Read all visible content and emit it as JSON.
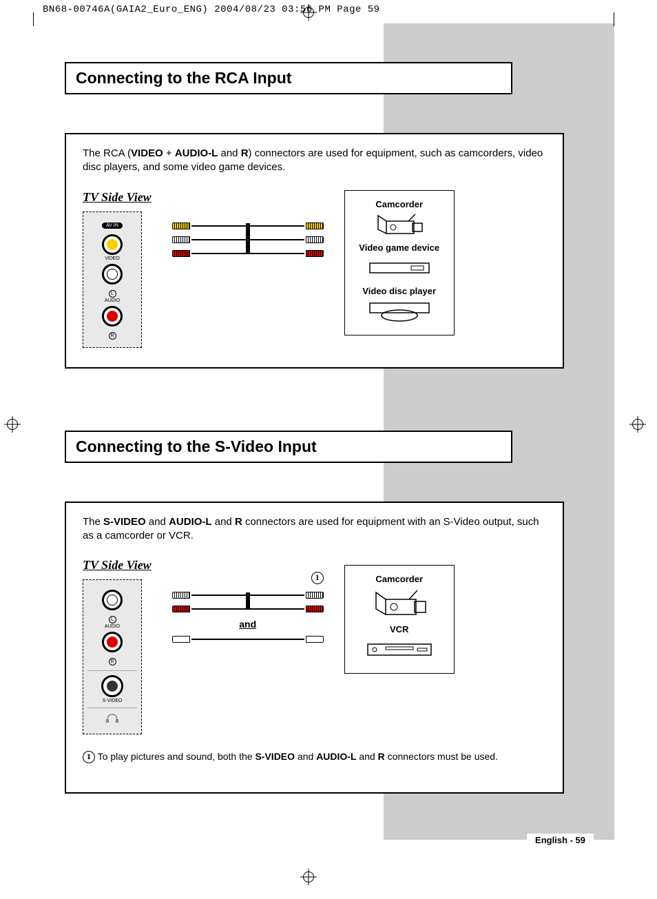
{
  "header_print": "BN68-00746A(GAIA2_Euro_ENG)  2004/08/23  03:56 PM  Page 59",
  "page_footer": "English - 59",
  "section1": {
    "title": "Connecting to the RCA Input",
    "intro_1": "The RCA (",
    "intro_b1": "VIDEO",
    "intro_2": " + ",
    "intro_b2": "AUDIO-L",
    "intro_3": " and ",
    "intro_b3": "R",
    "intro_4": ") connectors are used for equipment, such as camcorders, video disc players, and some video game devices.",
    "tv_label": "TV Side View",
    "panel": {
      "av_in": "AV IN",
      "video": "VIDEO",
      "audio": "AUDIO",
      "l": "L",
      "r": "R"
    },
    "devices": {
      "camcorder": "Camcorder",
      "game": "Video game device",
      "disc": "Video disc player"
    }
  },
  "section2": {
    "title": "Connecting to the S-Video Input",
    "intro_1": "The ",
    "intro_b1": "S-VIDEO",
    "intro_2": " and ",
    "intro_b2": "AUDIO-L",
    "intro_3": " and ",
    "intro_b3": "R",
    "intro_4": " connectors are used for equipment with an S-Video output, such as a camcorder or VCR.",
    "tv_label": "TV Side View",
    "panel": {
      "audio": "AUDIO",
      "l": "L",
      "r": "R",
      "svideo": "S-VIDEO"
    },
    "marker": "1",
    "and": "and",
    "devices": {
      "camcorder": "Camcorder",
      "vcr": "VCR"
    },
    "note_num": "1",
    "note_1": "  To play pictures and sound, both the ",
    "note_b1": "S-VIDEO",
    "note_2": " and ",
    "note_b2": "AUDIO-L",
    "note_3": " and ",
    "note_b3": "R",
    "note_4": " connectors must be used."
  }
}
